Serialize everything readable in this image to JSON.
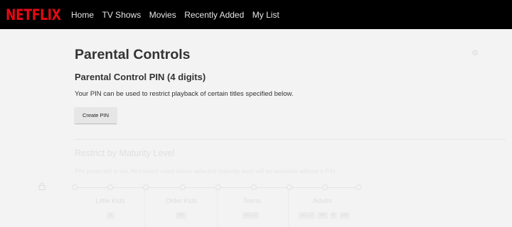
{
  "header": {
    "logo": "NETFLIX",
    "nav": [
      "Home",
      "TV Shows",
      "Movies",
      "Recently Added",
      "My List"
    ]
  },
  "page": {
    "title": "Parental Controls",
    "pin_title": "Parental Control PIN (4 digits)",
    "pin_description": "Your PIN can be used to restrict playback of certain titles specified below.",
    "create_pin_label": "Create PIN"
  },
  "maturity": {
    "heading": "Restrict by Maturity Level",
    "description": "PIN protected is set. All content rated above selected maturity level will be available without a PIN.",
    "levels": [
      {
        "label": "Little Kids",
        "badges": [
          "G"
        ]
      },
      {
        "label": "Older Kids",
        "badges": [
          "PG"
        ]
      },
      {
        "label": "Teens",
        "badges": [
          "PG-13"
        ]
      },
      {
        "label": "Adults",
        "badges": [
          "NC-17",
          "NR",
          "R",
          "UR"
        ]
      }
    ]
  },
  "colors": {
    "brand": "#e50914",
    "topbar": "#000000",
    "background": "#f3f3f3"
  }
}
